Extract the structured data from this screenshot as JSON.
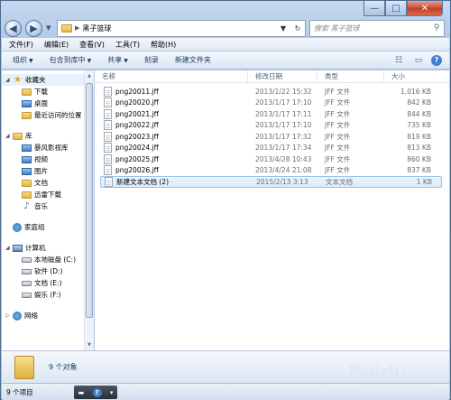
{
  "window": {
    "controls": {
      "minimize": "—",
      "maximize": "□",
      "close": "✕"
    }
  },
  "address_bar": {
    "back": "◀",
    "forward": "▶",
    "path": "黑子篮球",
    "search_placeholder": "搜索 黑子篮球"
  },
  "menu": [
    "文件(F)",
    "编辑(E)",
    "查看(V)",
    "工具(T)",
    "帮助(H)"
  ],
  "toolbar": {
    "organize": "组织",
    "include_in_library": "包含到库中",
    "share": "共享",
    "burn": "刻录",
    "new_folder": "新建文件夹"
  },
  "nav": {
    "favorites": {
      "label": "收藏夹",
      "items": [
        "下载",
        "桌面",
        "最近访问的位置"
      ]
    },
    "libraries": {
      "label": "库",
      "items": [
        "暴风影视库",
        "视频",
        "图片",
        "文档",
        "迅雷下载",
        "音乐"
      ]
    },
    "homegroup": "家庭组",
    "computer": {
      "label": "计算机",
      "items": [
        "本地磁盘 (C:)",
        "软件 (D:)",
        "文档 (E:)",
        "娱乐 (F:)"
      ]
    },
    "network": "网络"
  },
  "columns": {
    "name": "名称",
    "date": "修改日期",
    "type": "类型",
    "size": "大小"
  },
  "files": [
    {
      "name": "png20011.jff",
      "date": "2013/1/22 15:32",
      "type": "JFF 文件",
      "size": "1,016 KB"
    },
    {
      "name": "png20020.jff",
      "date": "2013/1/17 17:10",
      "type": "JFF 文件",
      "size": "842 KB"
    },
    {
      "name": "png20021.jff",
      "date": "2013/1/17 17:11",
      "type": "JFF 文件",
      "size": "844 KB"
    },
    {
      "name": "png20022.jff",
      "date": "2013/1/17 17:10",
      "type": "JFF 文件",
      "size": "735 KB"
    },
    {
      "name": "png20023.jff",
      "date": "2013/1/17 17:32",
      "type": "JFF 文件",
      "size": "819 KB"
    },
    {
      "name": "png20024.jff",
      "date": "2013/1/17 17:34",
      "type": "JFF 文件",
      "size": "813 KB"
    },
    {
      "name": "png20025.jff",
      "date": "2013/4/28 10:43",
      "type": "JFF 文件",
      "size": "860 KB"
    },
    {
      "name": "png20026.jff",
      "date": "2013/4/24 21:08",
      "type": "JFF 文件",
      "size": "837 KB"
    },
    {
      "name": "新建文本文档 (2)",
      "date": "2015/2/13 3:13",
      "type": "文本文档",
      "size": "1 KB"
    }
  ],
  "details": {
    "count_text": "9 个对象"
  },
  "status": {
    "items_text": "9 个项目"
  },
  "watermark": {
    "brand": "Baidu",
    "sub": "经验",
    "url": "jingyan.baidu.com"
  }
}
